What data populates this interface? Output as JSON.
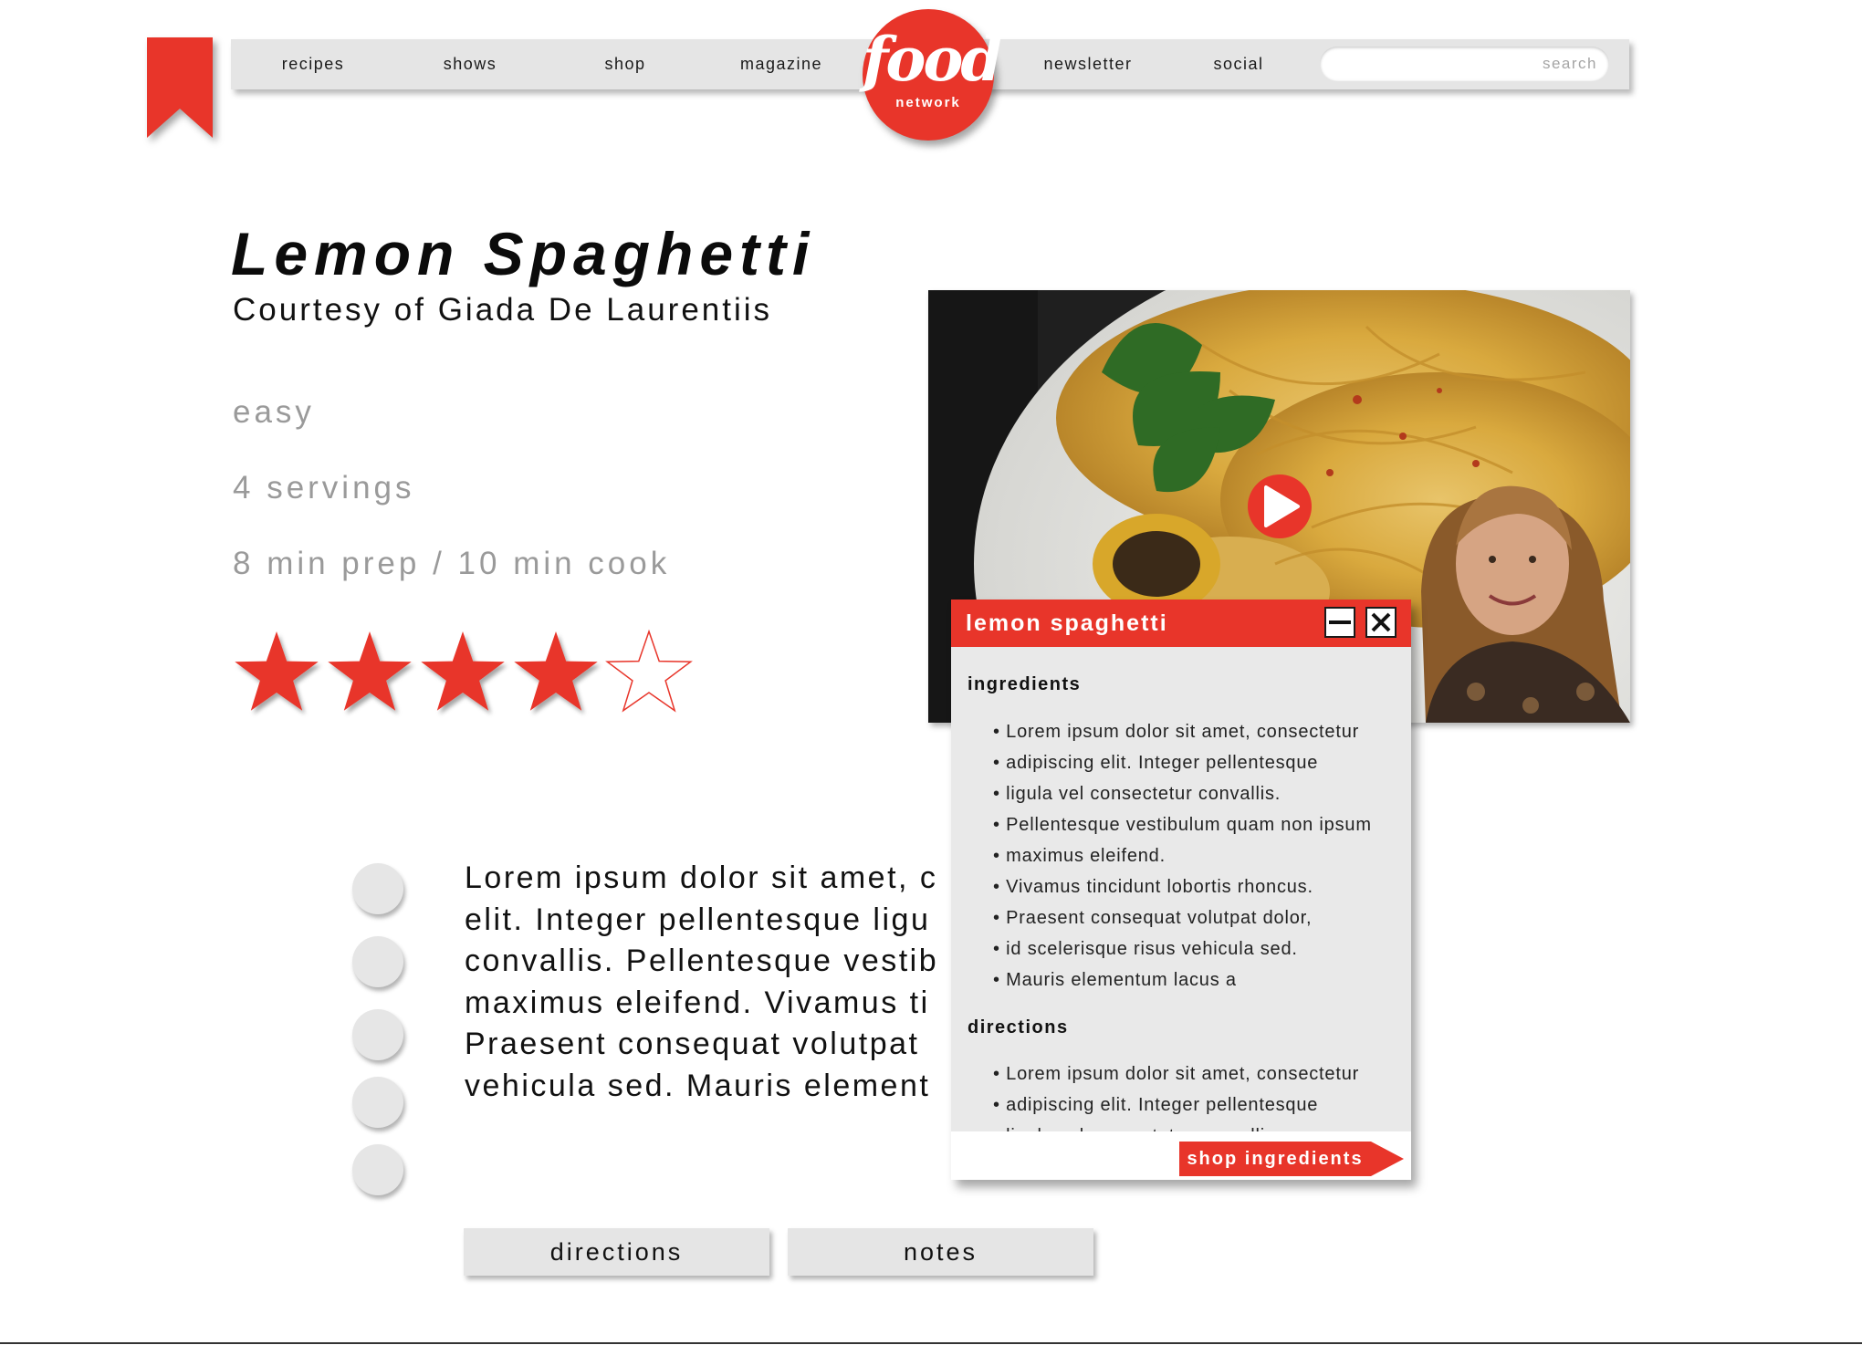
{
  "nav": {
    "left_items": [
      "recipes",
      "shows",
      "shop",
      "magazine"
    ],
    "right_items": [
      "newsletter",
      "social"
    ],
    "search_placeholder": "search"
  },
  "logo": {
    "word": "food",
    "sub": "network"
  },
  "recipe": {
    "title": "Lemon Spaghetti",
    "author": "Courtesy of Giada De Laurentiis",
    "difficulty": "easy",
    "servings": "4 servings",
    "time": "8 min prep / 10 min cook",
    "rating": 4,
    "rating_max": 5,
    "body_lines": [
      "Lorem ipsum dolor sit amet, c",
      "elit. Integer pellentesque ligu",
      "convallis. Pellentesque vestib",
      "maximus eleifend. Vivamus ti",
      "Praesent consequat volutpat",
      "vehicula sed. Mauris element"
    ],
    "step_count": 5
  },
  "tabs": {
    "directions": "directions",
    "notes": "notes"
  },
  "popup": {
    "title": "lemon spaghetti",
    "ingredients_heading": "ingredients",
    "ingredients": [
      "Lorem ipsum dolor sit amet, consectetur",
      "adipiscing elit. Integer pellentesque",
      "ligula vel consectetur convallis.",
      "Pellentesque vestibulum quam non ipsum",
      "maximus eleifend.",
      "Vivamus tincidunt lobortis rhoncus.",
      "Praesent consequat volutpat dolor,",
      "id scelerisque risus vehicula sed.",
      "Mauris elementum lacus a"
    ],
    "directions_heading": "directions",
    "directions": [
      "Lorem ipsum dolor sit amet, consectetur",
      "adipiscing elit. Integer pellentesque",
      "ligula vel consectetur convallis."
    ],
    "shop_button": "shop ingredients"
  },
  "colors": {
    "accent": "#e8352a",
    "bar": "#e5e5e5",
    "muted_text": "#9a9a9a"
  }
}
